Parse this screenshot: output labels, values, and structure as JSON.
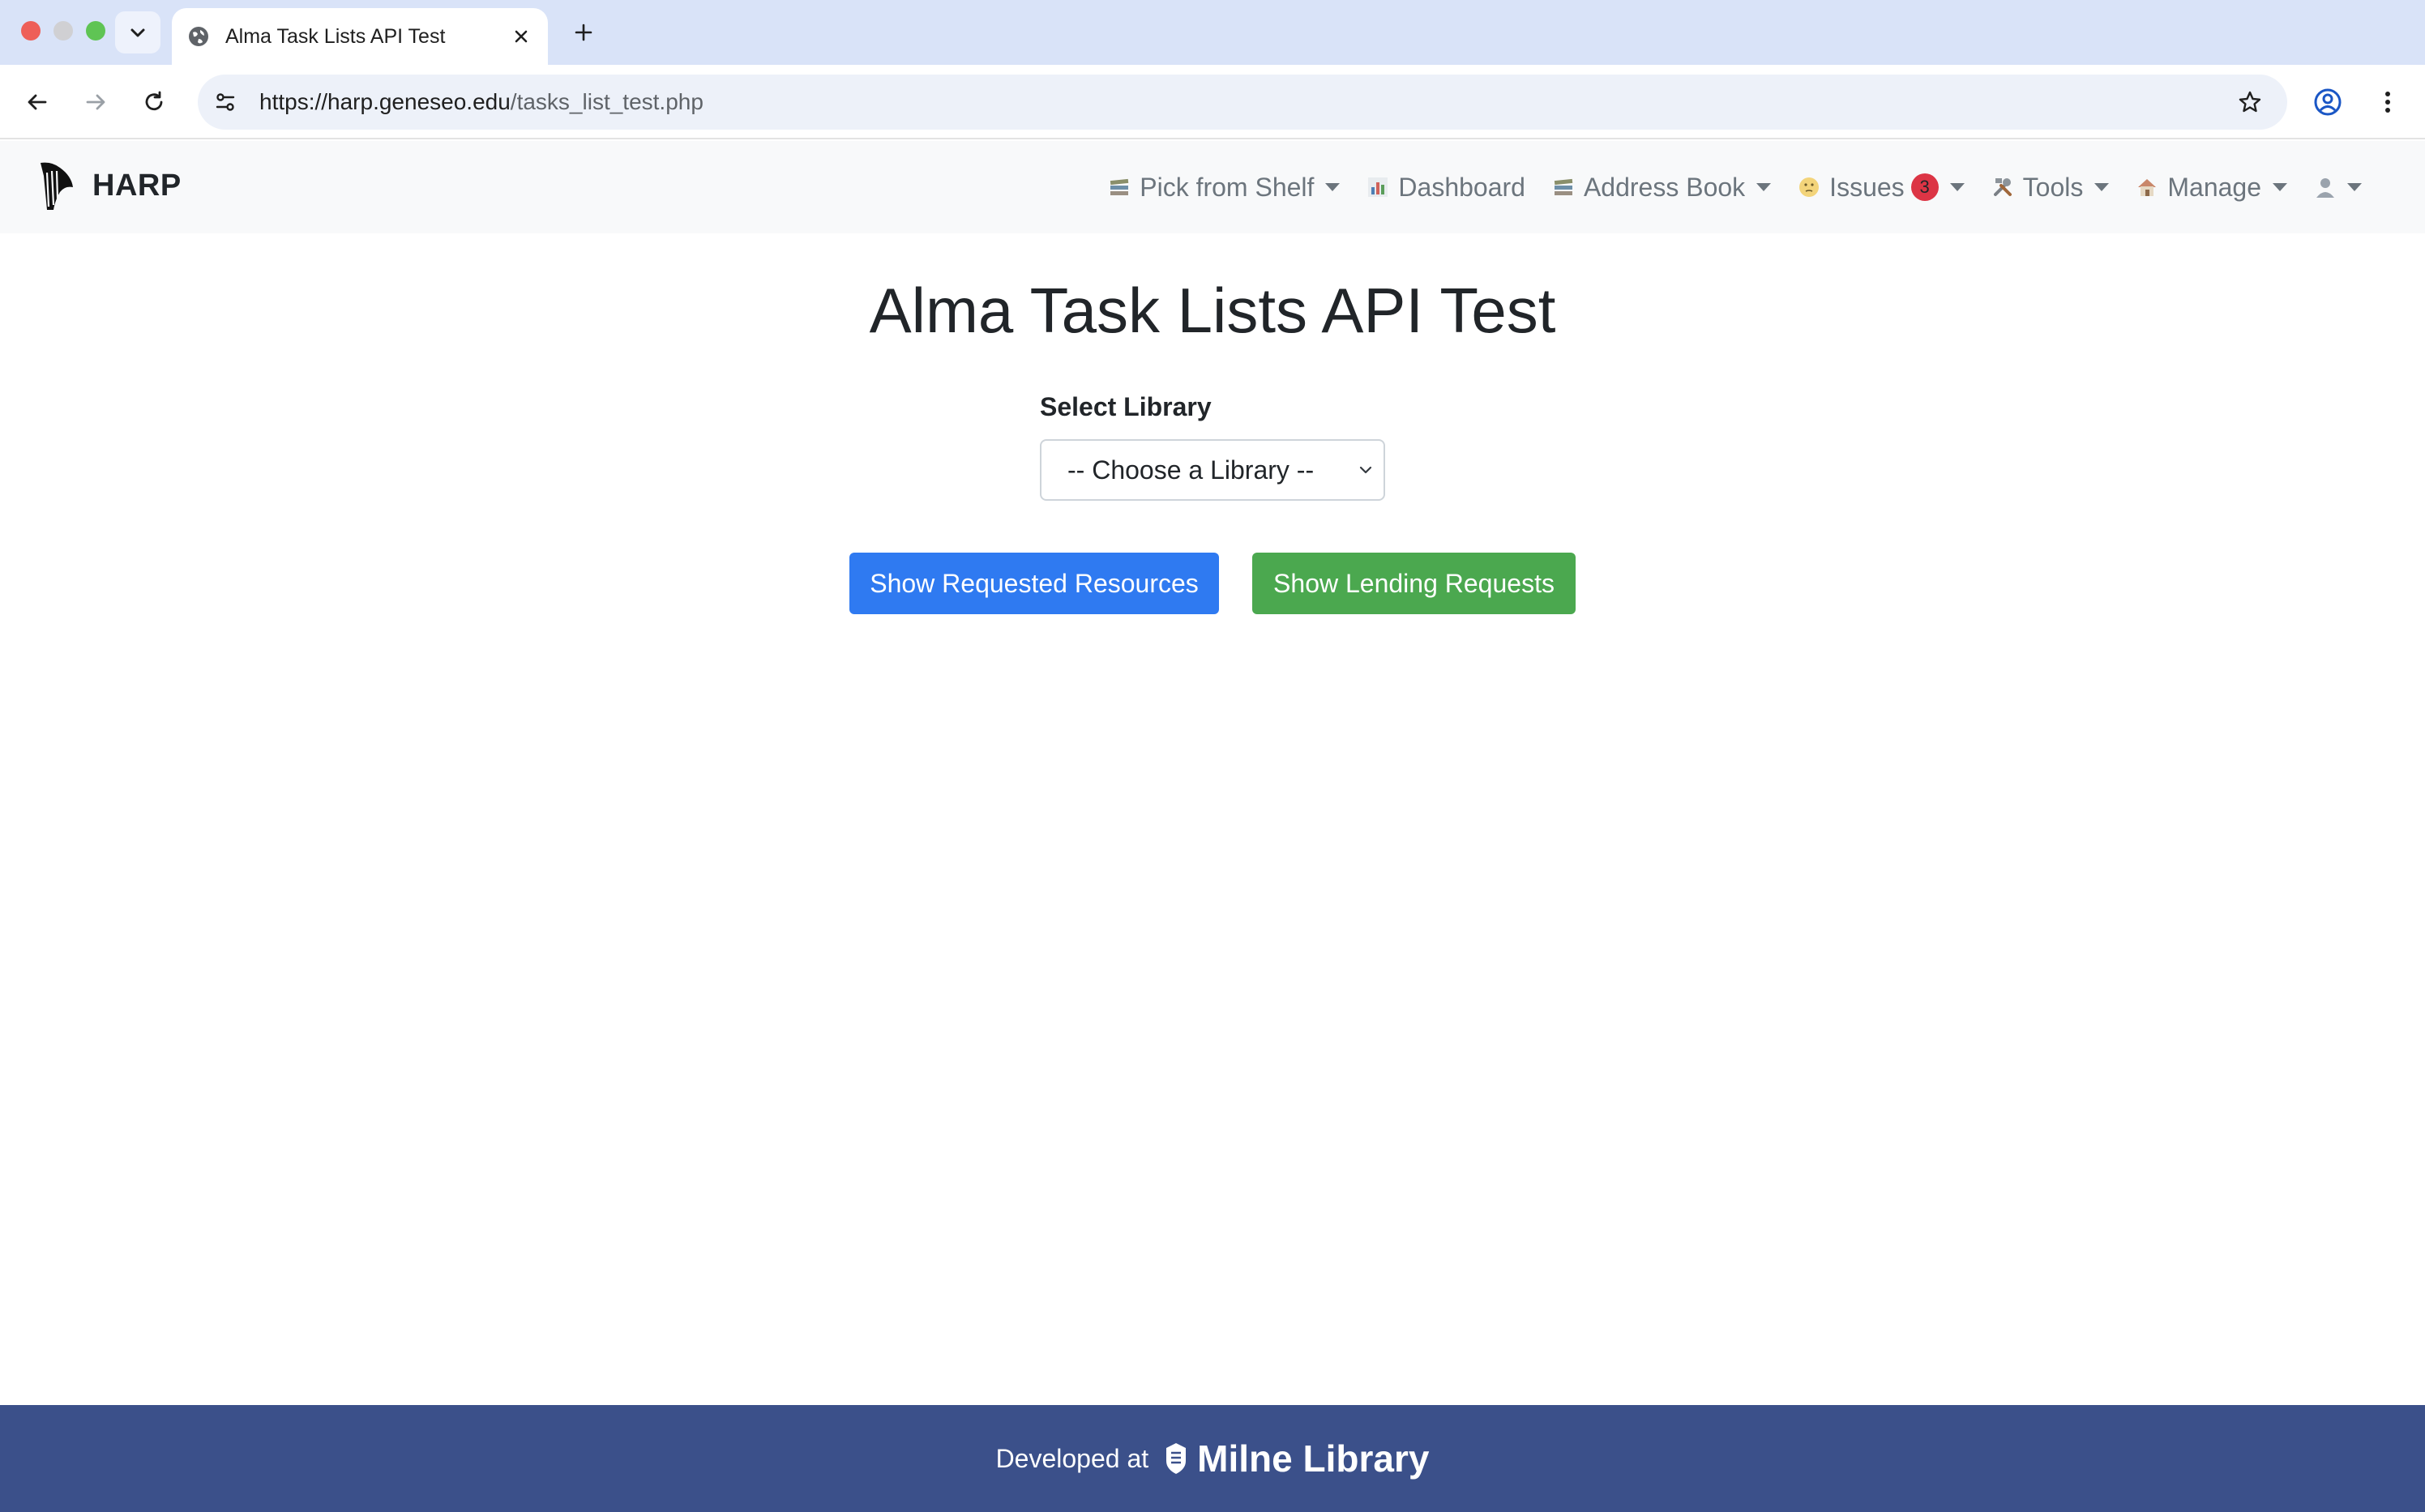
{
  "browser": {
    "tab_title": "Alma Task Lists API Test",
    "url_host": "https://harp.geneseo.edu",
    "url_path": "/tasks_list_test.php"
  },
  "navbar": {
    "brand": "HARP",
    "items": [
      {
        "label": "Pick from Shelf",
        "icon": "books-icon",
        "has_dropdown": true
      },
      {
        "label": "Dashboard",
        "icon": "bar-chart-icon",
        "has_dropdown": false
      },
      {
        "label": "Address Book",
        "icon": "books-icon",
        "has_dropdown": true
      },
      {
        "label": "Issues",
        "icon": "thinking-face-icon",
        "has_dropdown": true,
        "badge": "3"
      },
      {
        "label": "Tools",
        "icon": "tools-icon",
        "has_dropdown": true
      },
      {
        "label": "Manage",
        "icon": "house-icon",
        "has_dropdown": true
      },
      {
        "label": "",
        "icon": "user-icon",
        "has_dropdown": true
      }
    ]
  },
  "main": {
    "title": "Alma Task Lists API Test",
    "select_label": "Select Library",
    "select_value": "-- Choose a Library --",
    "button_requested": "Show Requested Resources",
    "button_lending": "Show Lending Requests"
  },
  "footer": {
    "text": "Developed at",
    "logo_text": "Milne Library"
  },
  "colors": {
    "primary_button": "#2f7af1",
    "success_button": "#4ba84f",
    "footer_bg": "#3b508a",
    "badge": "#dc3545"
  }
}
